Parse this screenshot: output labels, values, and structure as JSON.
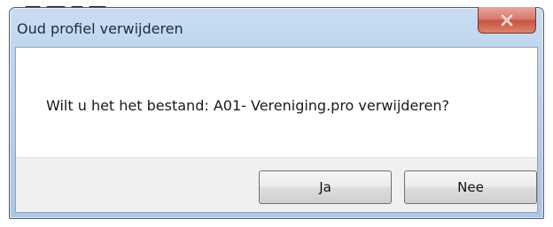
{
  "dialog": {
    "title": "Oud profiel verwijderen",
    "message": "Wilt u het het bestand: A01- Vereniging.pro verwijderen?",
    "buttons": {
      "yes_label": "Ja",
      "no_label": "Nee"
    },
    "close_icon": "close-icon"
  },
  "colors": {
    "titlebar": "#bfd5ee",
    "close_button": "#c85440",
    "button_area": "#f0f0f0",
    "client_background": "#ffffff"
  }
}
